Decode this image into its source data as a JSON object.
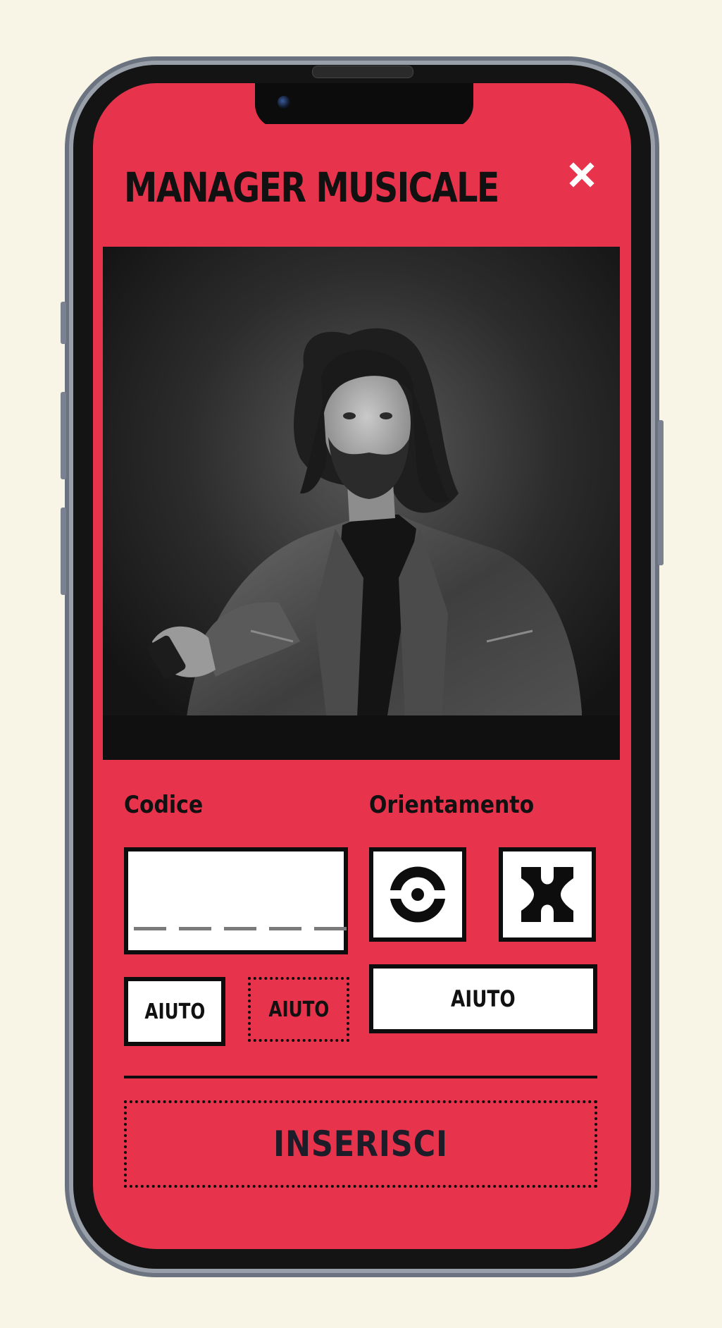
{
  "header": {
    "title": "MANAGER MUSICALE",
    "close_icon": "close-icon"
  },
  "photo": {
    "subject": "portrait-photo"
  },
  "form": {
    "code_label": "Codice",
    "orientation_label": "Orientamento",
    "code_value": "",
    "code_slots": 5,
    "orientation_options": [
      {
        "icon": "circle-target-icon"
      },
      {
        "icon": "hourglass-bracket-icon"
      }
    ],
    "help_left_label": "AIUTO",
    "help_middle_label": "AIUTO",
    "help_right_label": "AIUTO",
    "submit_label": "INSERISCI"
  },
  "colors": {
    "background": "#f8f5e6",
    "accent": "#e8334c",
    "ink": "#0d0d0d",
    "field": "#ffffff"
  }
}
